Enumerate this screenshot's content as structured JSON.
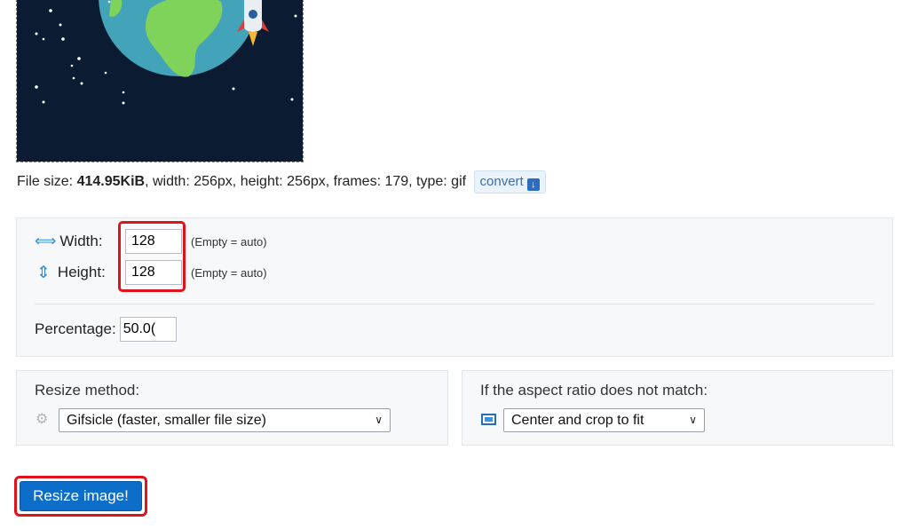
{
  "file_info": {
    "prefix": "File size: ",
    "size": "414.95KiB",
    "details": ", width: 256px, height: 256px, frames: 179, type: gif",
    "convert_label": "convert"
  },
  "dimensions": {
    "width_label": "Width:",
    "width_value": "128",
    "width_hint": "(Empty = auto)",
    "height_label": "Height:",
    "height_value": "128",
    "height_hint": "(Empty = auto)",
    "percentage_label": "Percentage:",
    "percentage_value": "50.0("
  },
  "resize_method": {
    "label": "Resize method:",
    "selected": "Gifsicle (faster, smaller file size)"
  },
  "aspect": {
    "label": "If the aspect ratio does not match:",
    "selected": "Center and crop to fit"
  },
  "submit_label": "Resize image!",
  "colors": {
    "preview_bg": "#0b1c32",
    "highlight": "#e0121c",
    "primary_button": "#0d6ec9",
    "icon_blue": "#2e8fd8"
  }
}
